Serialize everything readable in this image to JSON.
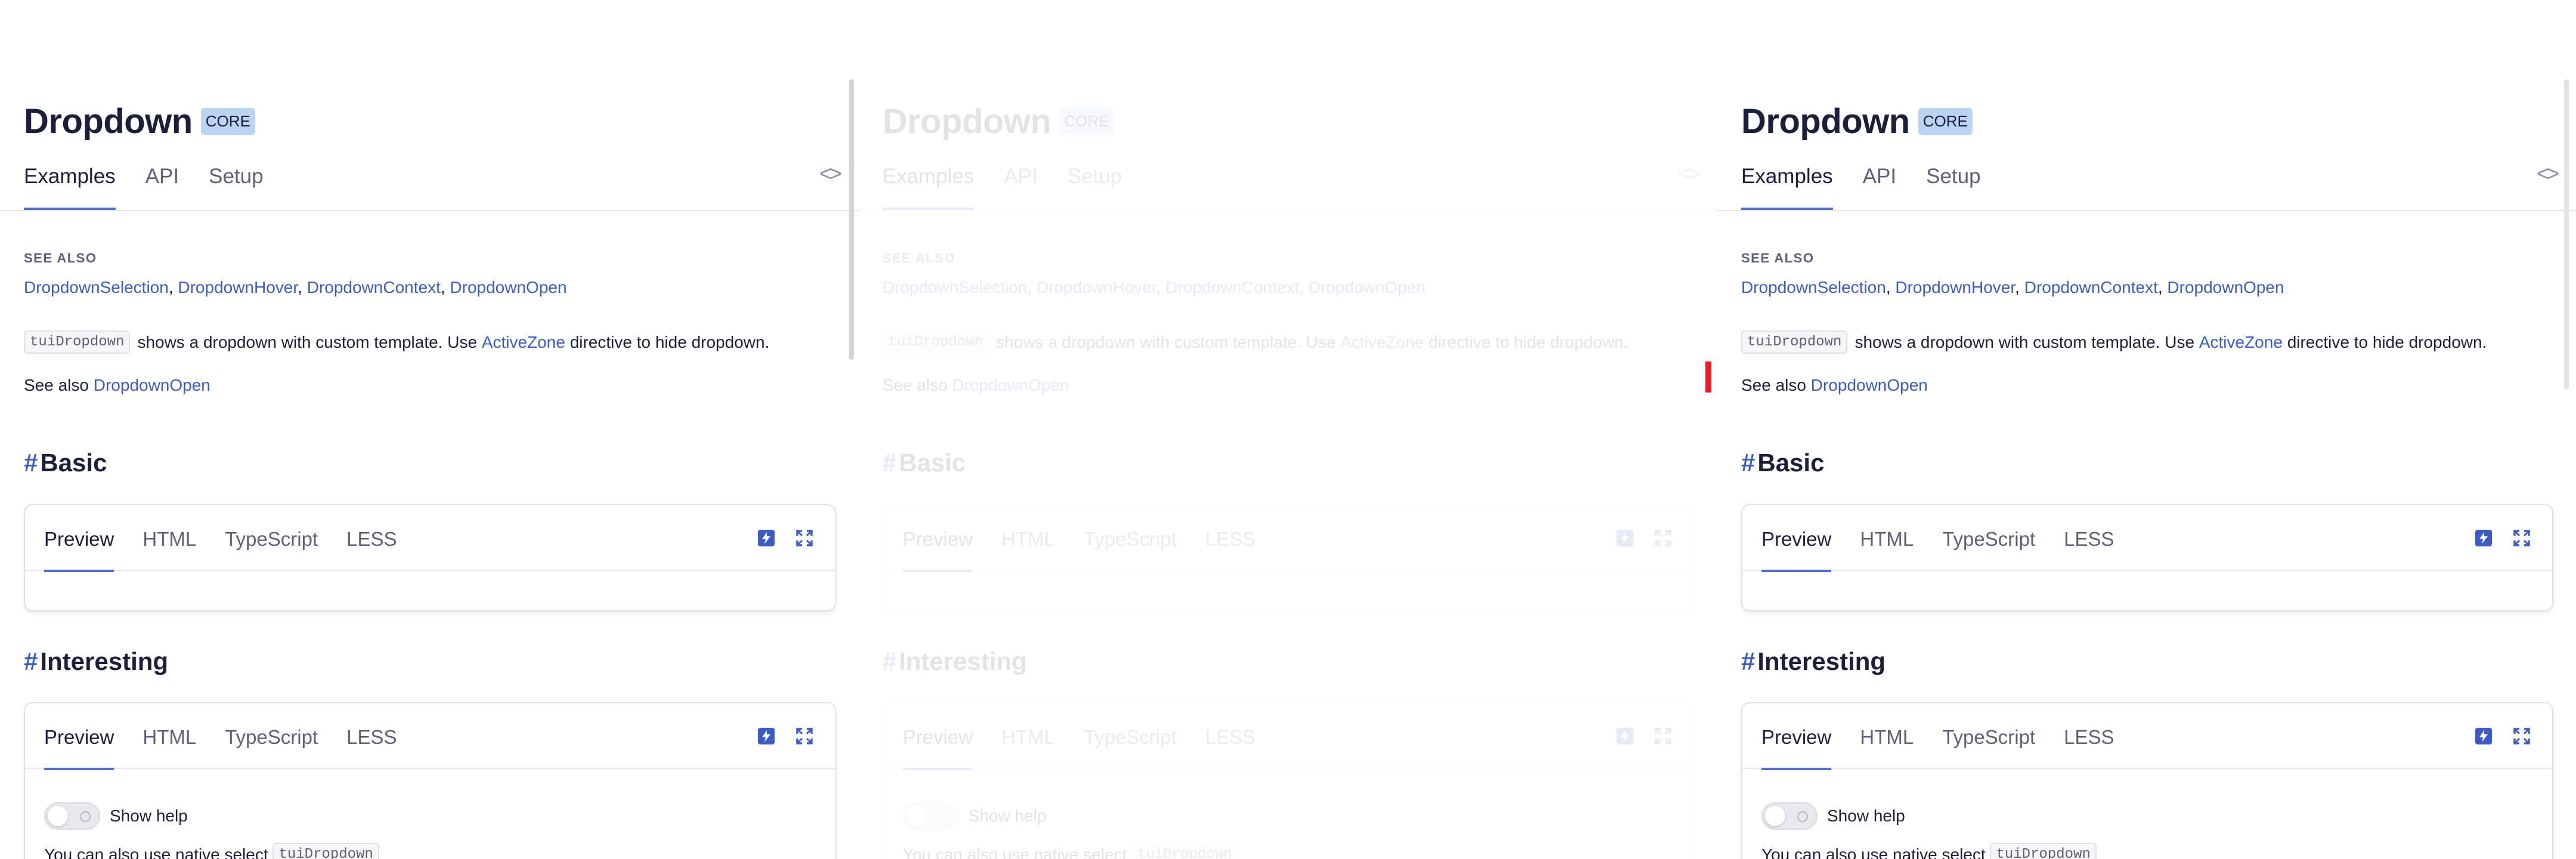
{
  "header": {
    "title": "Dropdown",
    "badge": "CORE",
    "tabs": [
      "Examples",
      "API",
      "Setup"
    ],
    "code_toggle": "<>"
  },
  "see_also": {
    "title": "SEE ALSO",
    "links": [
      "DropdownSelection",
      "DropdownHover",
      "DropdownContext",
      "DropdownOpen"
    ],
    "separator": ", "
  },
  "description": {
    "code": "tuiDropdown",
    "text_before": "shows a dropdown with custom template. Use",
    "link": "ActiveZone",
    "text_after": "directive to hide dropdown."
  },
  "see_also_line": {
    "prefix": "See also",
    "link": "DropdownOpen"
  },
  "sections": [
    {
      "hash": "#",
      "title": "Basic",
      "tabs": [
        "Preview",
        "HTML",
        "TypeScript",
        "LESS"
      ],
      "icons": [
        "stackblitz-icon",
        "fullscreen-icon"
      ]
    },
    {
      "hash": "#",
      "title": "Interesting",
      "tabs": [
        "Preview",
        "HTML",
        "TypeScript",
        "LESS"
      ],
      "icons": [
        "stackblitz-icon",
        "fullscreen-icon"
      ],
      "toggle_label": "Show help",
      "help_text": "You can also use native select",
      "help_code": "tuiDropdown"
    }
  ],
  "colors": {
    "accent": "#526ed3",
    "link": "#3c5bc6",
    "badge_bg": "#bcd4f3",
    "marker": "#ec1c24"
  }
}
